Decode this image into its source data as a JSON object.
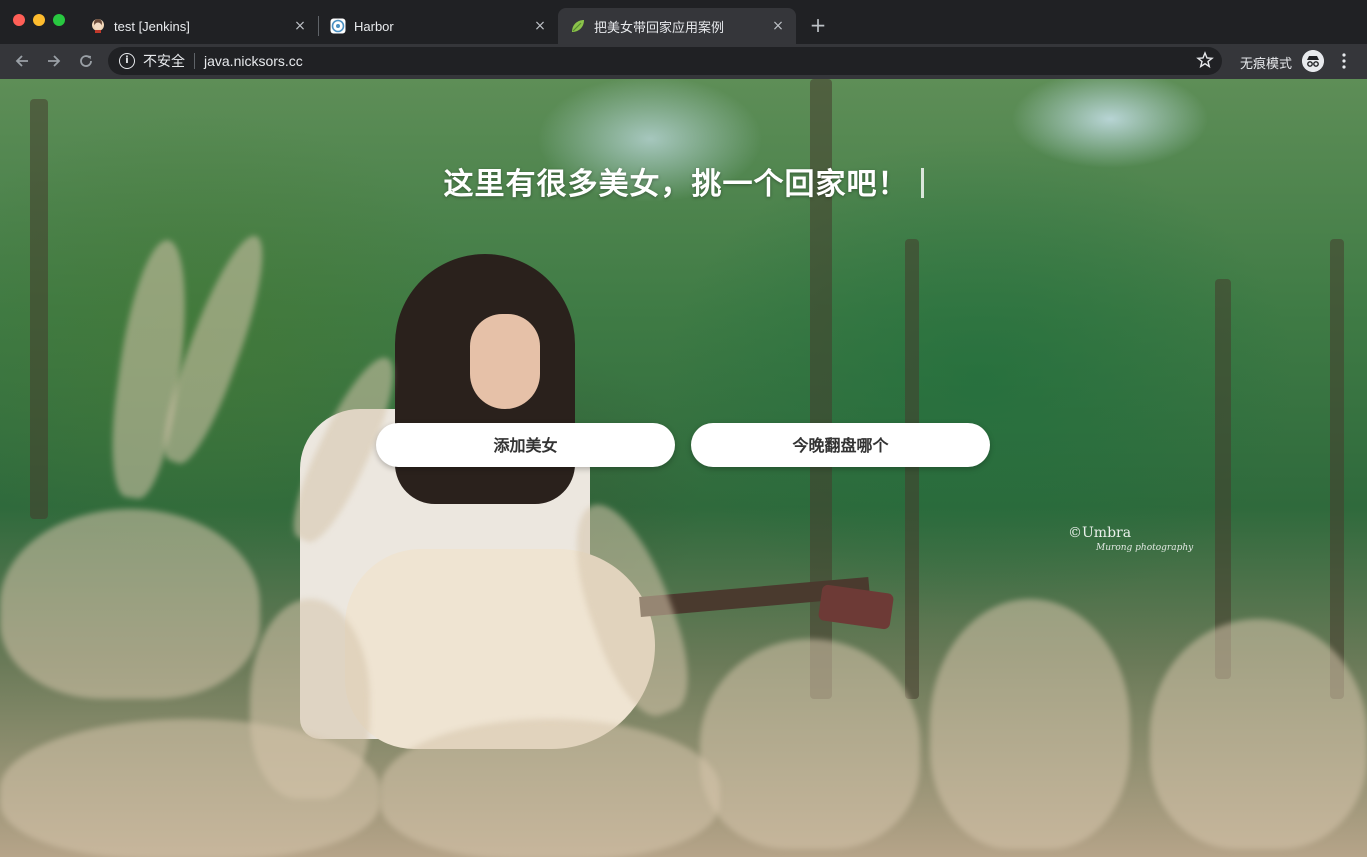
{
  "browser": {
    "tabs": [
      {
        "label": "test [Jenkins]",
        "icon": "jenkins-icon",
        "active": false
      },
      {
        "label": "Harbor",
        "icon": "harbor-icon",
        "active": false
      },
      {
        "label": "把美女带回家应用案例",
        "icon": "leaf-icon",
        "active": true
      }
    ],
    "new_tab": "+",
    "close_glyph": "×",
    "security_label": "不安全",
    "url": "java.nicksors.cc",
    "incognito_label": "无痕模式"
  },
  "page": {
    "headline": "这里有很多美女，挑一个回家吧！",
    "buttons": {
      "add": "添加美女",
      "pick": "今晚翻盘哪个"
    },
    "watermark": {
      "main": "©Umbra",
      "sub": "Murong photography"
    }
  }
}
